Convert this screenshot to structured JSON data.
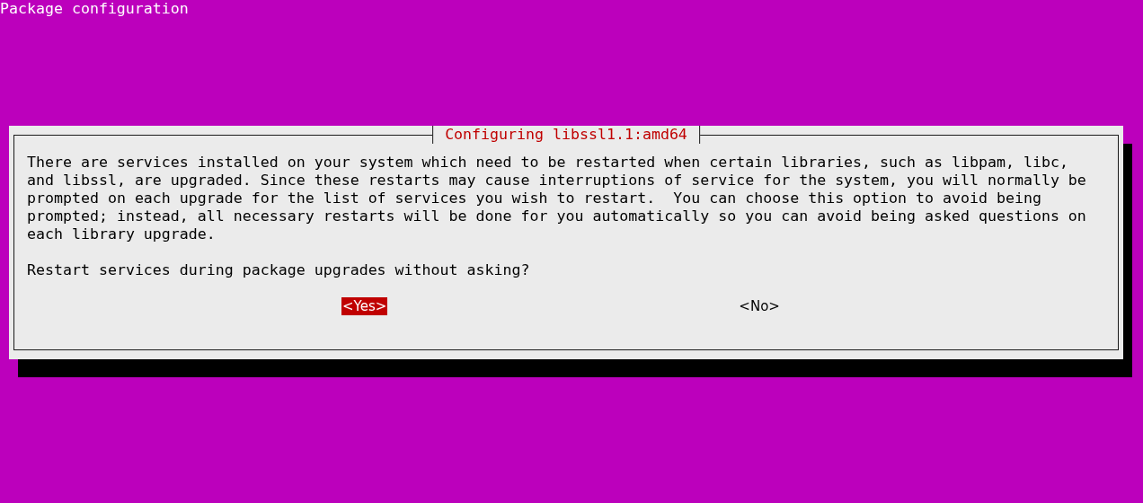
{
  "screen": {
    "title": "Package configuration"
  },
  "dialog": {
    "title": "Configuring libssl1.1:amd64",
    "message": "There are services installed on your system which need to be restarted when certain libraries, such as libpam, libc,\nand libssl, are upgraded. Since these restarts may cause interruptions of service for the system, you will normally be\nprompted on each upgrade for the list of services you wish to restart.  You can choose this option to avoid being\nprompted; instead, all necessary restarts will be done for you automatically so you can avoid being asked questions on\neach library upgrade.",
    "question": "Restart services during package upgrades without asking?",
    "buttons": [
      {
        "label": "<Yes>",
        "selected": true
      },
      {
        "label": "<No>",
        "selected": false
      }
    ]
  }
}
